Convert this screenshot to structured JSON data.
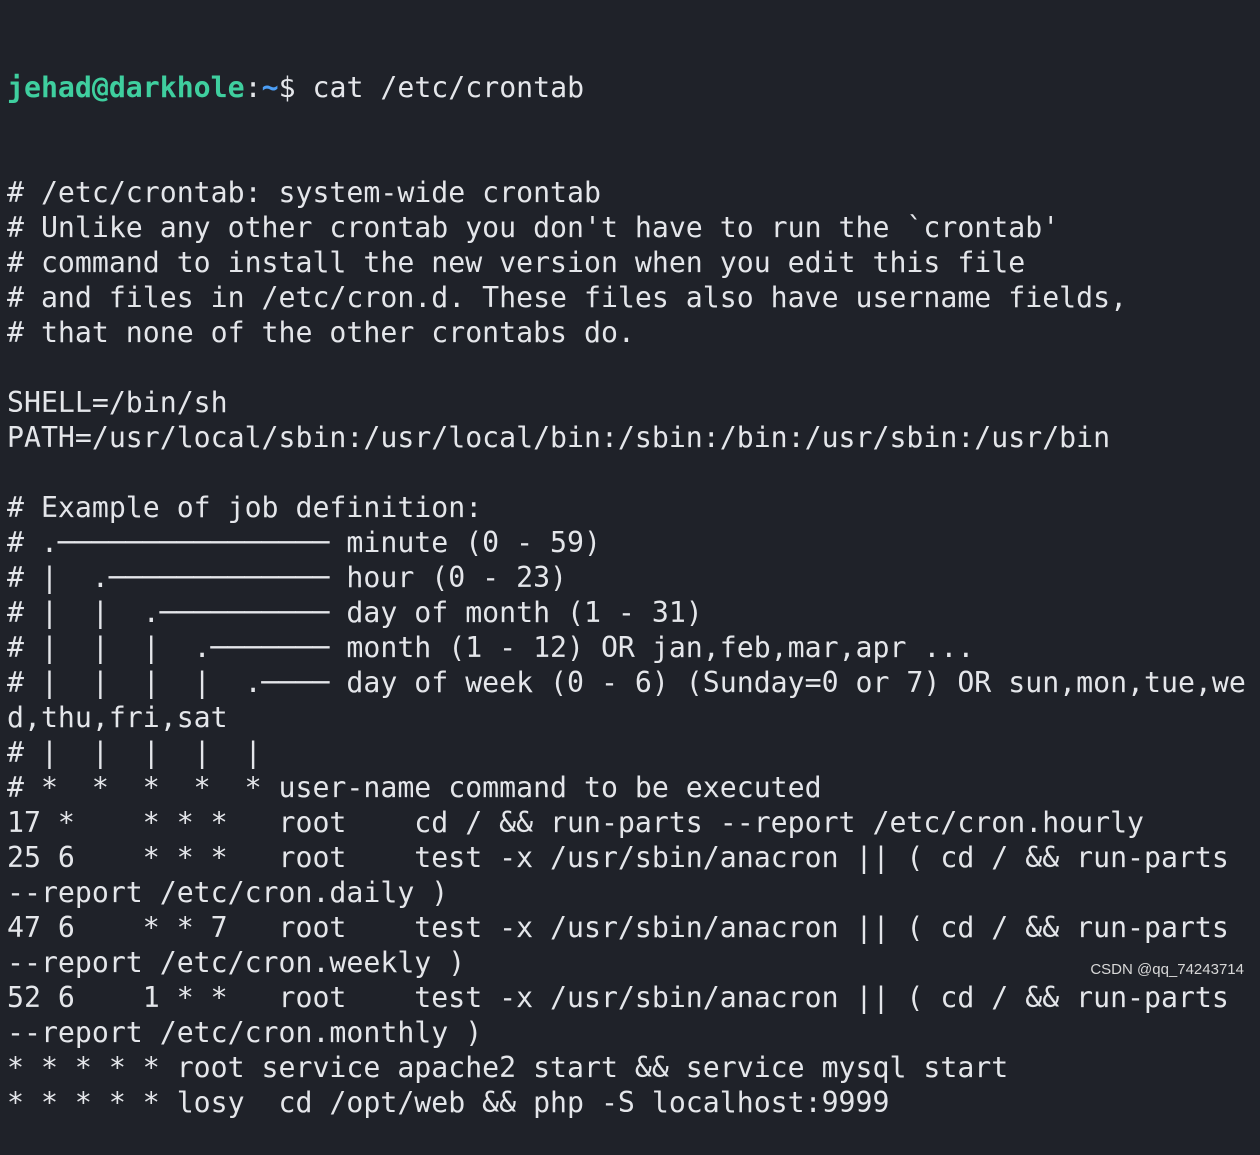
{
  "prompt": {
    "user_host": "jehad@darkhole",
    "colon": ":",
    "path": "~",
    "symbol": "$ ",
    "command": "cat /etc/crontab"
  },
  "output_lines": [
    "# /etc/crontab: system-wide crontab",
    "# Unlike any other crontab you don't have to run the `crontab'",
    "# command to install the new version when you edit this file",
    "# and files in /etc/cron.d. These files also have username fields,",
    "# that none of the other crontabs do.",
    "",
    "SHELL=/bin/sh",
    "PATH=/usr/local/sbin:/usr/local/bin:/sbin:/bin:/usr/sbin:/usr/bin",
    "",
    "# Example of job definition:",
    "# .──────────────── minute (0 - 59)",
    "# |  .───────────── hour (0 - 23)",
    "# |  |  .────────── day of month (1 - 31)",
    "# |  |  |  .─────── month (1 - 12) OR jan,feb,mar,apr ...",
    "# |  |  |  |  .──── day of week (0 - 6) (Sunday=0 or 7) OR sun,mon,tue,we",
    "d,thu,fri,sat",
    "# |  |  |  |  |",
    "# *  *  *  *  * user-name command to be executed",
    "17 *    * * *   root    cd / && run-parts --report /etc/cron.hourly",
    "25 6    * * *   root    test -x /usr/sbin/anacron || ( cd / && run-parts",
    "--report /etc/cron.daily )",
    "47 6    * * 7   root    test -x /usr/sbin/anacron || ( cd / && run-parts",
    "--report /etc/cron.weekly )",
    "52 6    1 * *   root    test -x /usr/sbin/anacron || ( cd / && run-parts",
    "--report /etc/cron.monthly )",
    "* * * * * root service apache2 start && service mysql start",
    "* * * * * losy  cd /opt/web && php -S localhost:9999"
  ],
  "watermark": "CSDN @qq_74243714",
  "colors": {
    "background": "#1f2229",
    "text": "#e4e6ea",
    "prompt_user": "#3fcf9f",
    "prompt_path": "#4c9ef5"
  }
}
